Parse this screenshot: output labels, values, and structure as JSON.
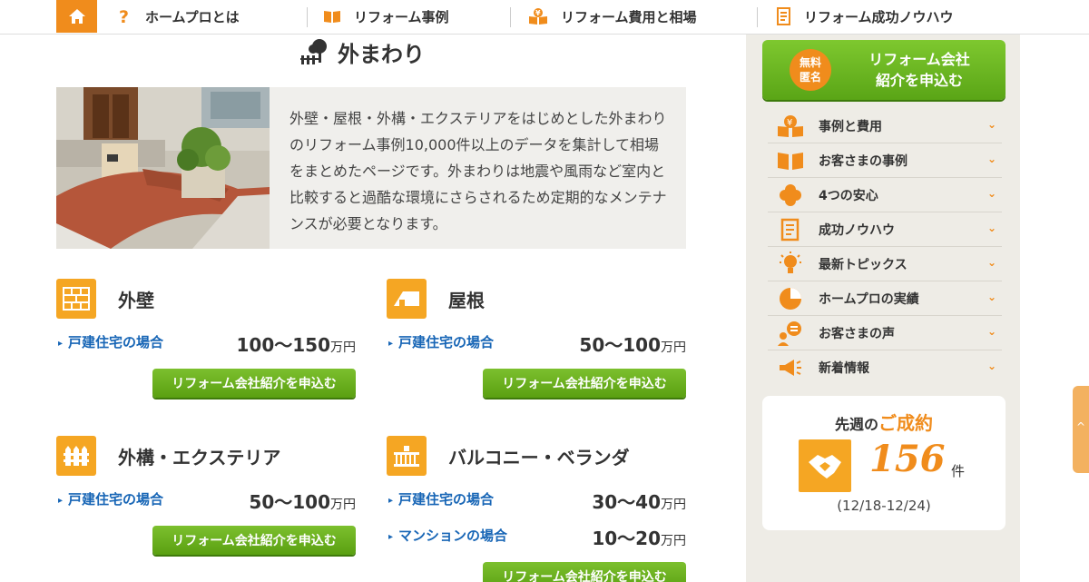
{
  "nav": {
    "items": [
      {
        "label": "ホームプロとは",
        "icon": "question-icon"
      },
      {
        "label": "リフォーム事例",
        "icon": "book-icon"
      },
      {
        "label": "リフォーム費用と相場",
        "icon": "price-book-icon"
      },
      {
        "label": "リフォーム成功ノウハウ",
        "icon": "note-icon"
      }
    ]
  },
  "page": {
    "title": "外まわり",
    "intro": "外壁・屋根・外構・エクステリアをはじめとした外まわりのリフォーム事例10,000件以上のデータを集計して相場をまとめたページです。外まわりは地震や風雨など室内と比較すると過酷な環境にさらされるため定期的なメンテナンスが必要となります。"
  },
  "categories": [
    {
      "title": "外壁",
      "icon": "brick-wall-icon",
      "rows": [
        {
          "label": "戸建住宅の場合",
          "value": "100～150",
          "unit": "万円"
        }
      ],
      "button": "リフォーム会社紹介を申込む"
    },
    {
      "title": "屋根",
      "icon": "roof-icon",
      "rows": [
        {
          "label": "戸建住宅の場合",
          "value": "50～100",
          "unit": "万円"
        }
      ],
      "button": "リフォーム会社紹介を申込む"
    },
    {
      "title": "外構・エクステリア",
      "icon": "fence-icon",
      "rows": [
        {
          "label": "戸建住宅の場合",
          "value": "50～100",
          "unit": "万円"
        }
      ],
      "button": "リフォーム会社紹介を申込む"
    },
    {
      "title": "バルコニー・ベランダ",
      "icon": "balcony-icon",
      "rows": [
        {
          "label": "戸建住宅の場合",
          "value": "30～40",
          "unit": "万円"
        },
        {
          "label": "マンションの場合",
          "value": "10～20",
          "unit": "万円"
        }
      ],
      "button": "リフォーム会社紹介を申込む"
    }
  ],
  "sidebar": {
    "cta": {
      "badge_line1": "無料",
      "badge_line2": "匿名",
      "line1": "リフォーム会社",
      "line2": "紹介を申込む"
    },
    "menu": [
      {
        "label": "事例と費用",
        "icon": "price-book-icon"
      },
      {
        "label": "お客さまの事例",
        "icon": "book-icon"
      },
      {
        "label": "4つの安心",
        "icon": "clover-icon"
      },
      {
        "label": "成功ノウハウ",
        "icon": "note-icon"
      },
      {
        "label": "最新トピックス",
        "icon": "lightbulb-icon"
      },
      {
        "label": "ホームプロの実績",
        "icon": "pie-chart-icon"
      },
      {
        "label": "お客さまの声",
        "icon": "speech-person-icon"
      },
      {
        "label": "新着情報",
        "icon": "megaphone-icon"
      }
    ],
    "stats": {
      "title_prefix": "先週の",
      "title_highlight": "ご成約",
      "count": "156",
      "unit": "件",
      "period": "(12/18-12/24)"
    }
  },
  "colors": {
    "accent": "#f08c1c",
    "green": "#5aa011",
    "link": "#1866b6",
    "icon_bg": "#f5a623"
  }
}
